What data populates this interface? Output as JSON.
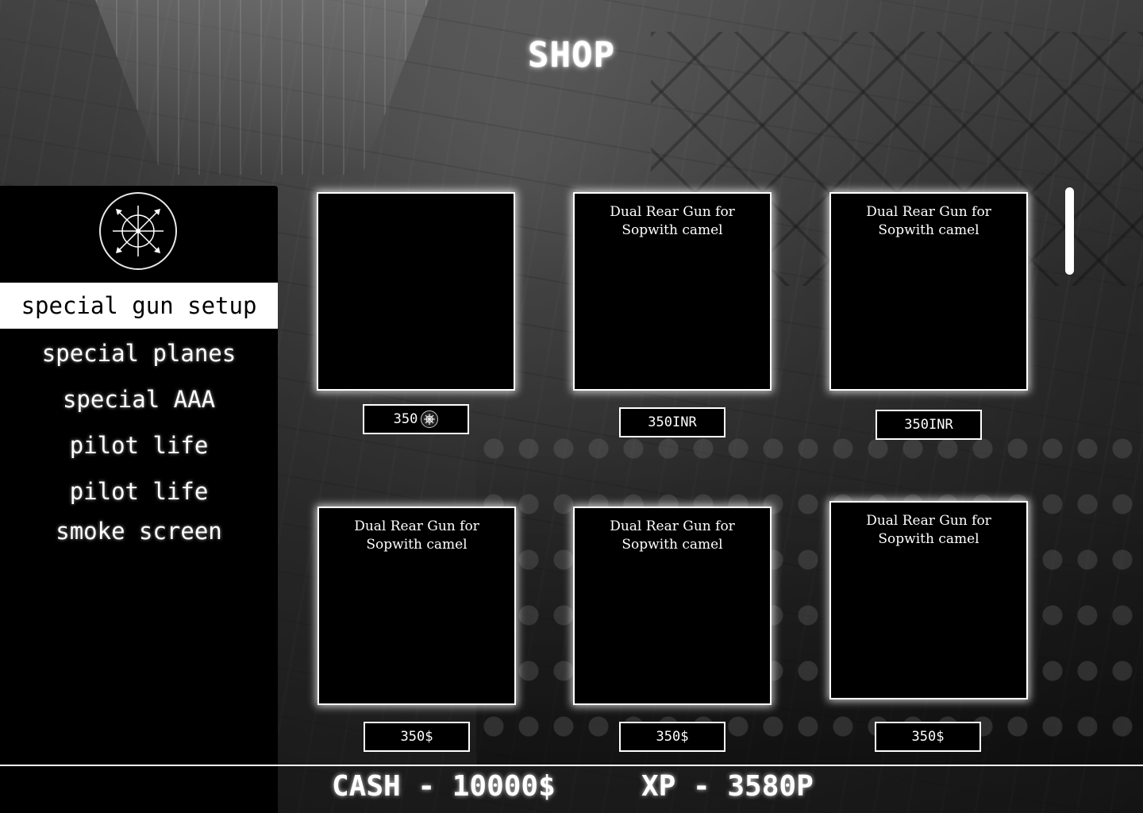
{
  "header": {
    "title": "SHOP"
  },
  "sidebar": {
    "emblem_icon": "crosshair-compass-icon",
    "items": [
      {
        "label": "special gun setup",
        "active": true
      },
      {
        "label": "special planes",
        "active": false
      },
      {
        "label": "special AAA",
        "active": false
      },
      {
        "label": "pilot life",
        "active": false
      },
      {
        "label": "pilot life",
        "active": false
      },
      {
        "label": "smoke screen",
        "active": false
      }
    ]
  },
  "items": [
    {
      "title": "",
      "price": "350",
      "currency_icon": "coin-icon"
    },
    {
      "title": "Dual Rear Gun for\nSopwith camel",
      "price": "350INR"
    },
    {
      "title": "Dual Rear Gun for\nSopwith camel",
      "price": "350INR"
    },
    {
      "title": "Dual Rear Gun for\nSopwith camel",
      "price": "350$"
    },
    {
      "title": "Dual Rear Gun for\nSopwith camel",
      "price": "350$"
    },
    {
      "title": "Dual Rear Gun for\nSopwith camel",
      "price": "350$"
    }
  ],
  "footer": {
    "cash": "CASH - 10000$",
    "xp": "XP - 3580P"
  }
}
